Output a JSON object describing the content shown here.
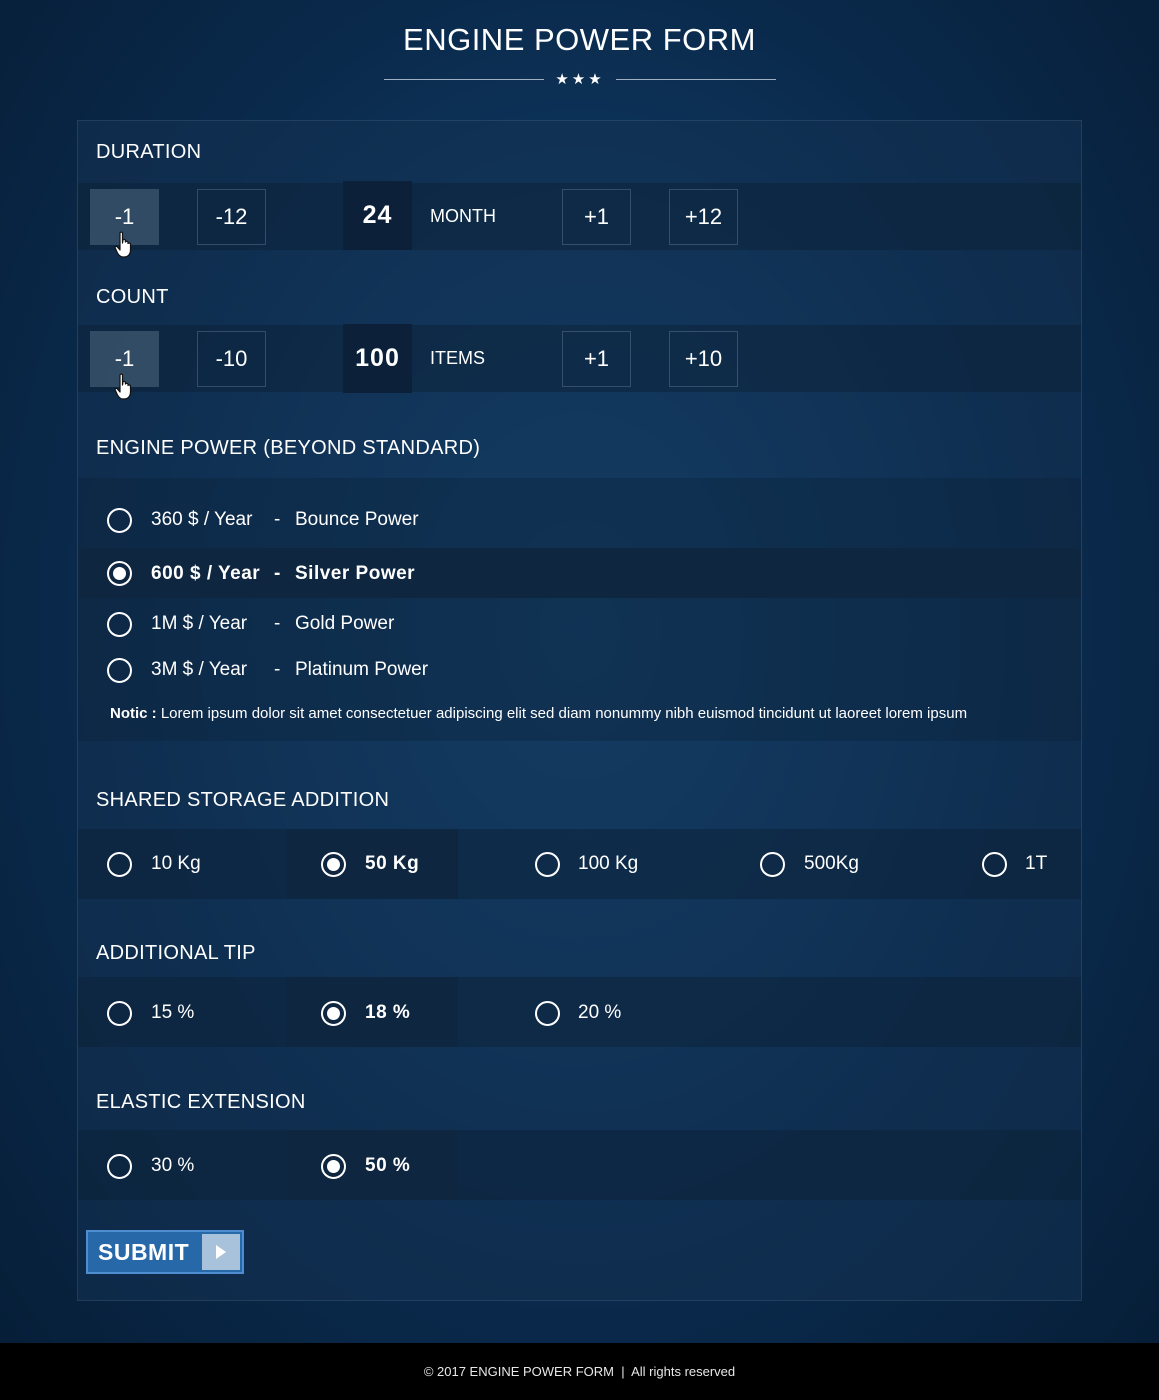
{
  "header": {
    "title": "ENGINE POWER FORM",
    "stars": "★★★"
  },
  "duration": {
    "title": "DURATION",
    "minus1": "-1",
    "minus12": "-12",
    "value": "24",
    "unit": "MONTH",
    "plus1": "+1",
    "plus12": "+12"
  },
  "count": {
    "title": "COUNT",
    "minus1": "-1",
    "minus10": "-10",
    "value": "100",
    "unit": "ITEMS",
    "plus1": "+1",
    "plus10": "+10"
  },
  "engine_power": {
    "title": "ENGINE POWER (BEYOND STANDARD)",
    "options": [
      {
        "price": "360 $ / Year",
        "sep": "-",
        "name": "Bounce Power",
        "checked": false
      },
      {
        "price": "600 $ / Year",
        "sep": "-",
        "name": "Silver Power",
        "checked": true
      },
      {
        "price": "1M $ / Year",
        "sep": "-",
        "name": "Gold Power",
        "checked": false
      },
      {
        "price": "3M $ / Year",
        "sep": "-",
        "name": "Platinum Power",
        "checked": false
      }
    ],
    "notice_label": "Notic :",
    "notice_text": "Lorem ipsum dolor sit amet consectetuer adipiscing elit sed diam nonummy nibh euismod tincidunt ut laoreet lorem ipsum"
  },
  "shared_storage": {
    "title": "SHARED STORAGE ADDITION",
    "options": [
      {
        "label": "10 Kg",
        "checked": false
      },
      {
        "label": "50 Kg",
        "checked": true
      },
      {
        "label": "100 Kg",
        "checked": false
      },
      {
        "label": "500Kg",
        "checked": false
      },
      {
        "label": "1T",
        "checked": false
      }
    ]
  },
  "additional_tip": {
    "title": "ADDITIONAL TIP",
    "options": [
      {
        "label": "15 %",
        "checked": false
      },
      {
        "label": "18 %",
        "checked": true
      },
      {
        "label": "20 %",
        "checked": false
      }
    ]
  },
  "elastic_extension": {
    "title": "ELASTIC EXTENSION",
    "options": [
      {
        "label": "30 %",
        "checked": false
      },
      {
        "label": "50 %",
        "checked": true
      }
    ]
  },
  "submit": {
    "label": "SUBMIT"
  },
  "footer": {
    "text": "© 2017 ENGINE POWER FORM  |  All rights reserved"
  },
  "colors": {
    "accent": "#2769a8",
    "arrow_box": "#a9c2dc",
    "selected_bg": "#0f2640",
    "value_bg": "#0c2139"
  }
}
